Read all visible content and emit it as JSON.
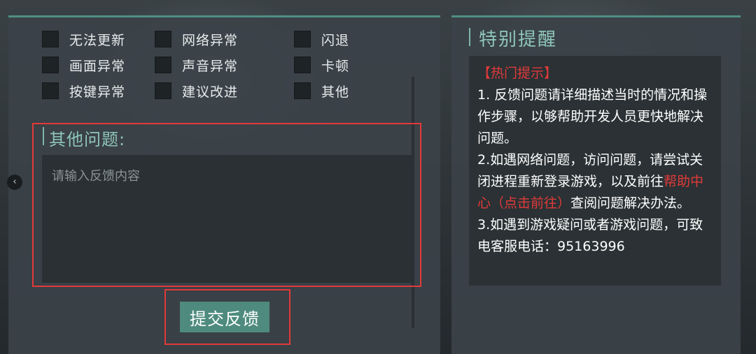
{
  "feedback": {
    "categories": [
      {
        "label": "无法更新"
      },
      {
        "label": "网络异常"
      },
      {
        "label": "闪退"
      },
      {
        "label": "画面异常"
      },
      {
        "label": "声音异常"
      },
      {
        "label": "卡顿"
      },
      {
        "label": "按键异常"
      },
      {
        "label": "建议改进"
      },
      {
        "label": "其他"
      }
    ],
    "other_title": "其他问题:",
    "input_placeholder": "请输入反馈内容",
    "submit_label": "提交反馈",
    "nav_prev_glyph": "‹"
  },
  "notice": {
    "title": "特别提醒",
    "hot_tip": "【热门提示】",
    "item1": "1. 反馈问题请详细描述当时的情况和操作步骤，以够帮助开发人员更快地解决问题。",
    "item2_prefix": "2.如遇网络问题，访问问题，请尝试关闭进程重新登录游戏，以及前往",
    "item2_link": "帮助中心（点击前往）",
    "item2_suffix": "查阅问题解决办法。",
    "item3": "3.如遇到游戏疑问或者游戏问题，可致电客服电话：95163996"
  },
  "colors": {
    "accent": "#4e8b7e",
    "title_accent": "#8fc6b8",
    "highlight_red": "#e23a3a"
  }
}
